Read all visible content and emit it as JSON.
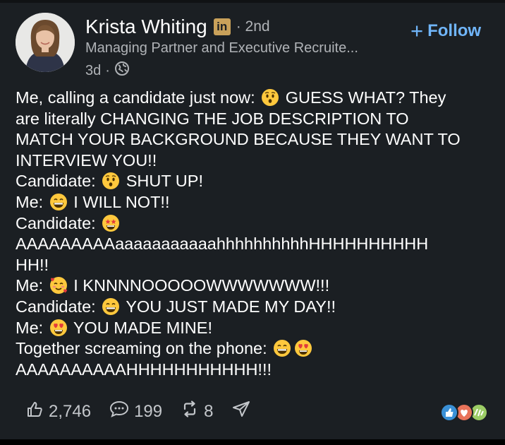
{
  "author": {
    "name": "Krista Whiting",
    "badge": "in",
    "degree": "· 2nd",
    "headline": "Managing Partner and Executive Recruite...",
    "time": "3d",
    "dot": "·"
  },
  "follow": {
    "label": "Follow"
  },
  "post": {
    "lines": [
      {
        "text": "Me, calling a candidate just now:",
        "emoji": [
          "hushed-face"
        ],
        "after": "GUESS WHAT? They"
      },
      {
        "text": "are literally CHANGING THE JOB DESCRIPTION TO"
      },
      {
        "text": "MATCH YOUR BACKGROUND BECAUSE THEY WANT TO"
      },
      {
        "text": "INTERVIEW YOU!!"
      },
      {
        "text": "Candidate:",
        "emoji": [
          "hushed-face"
        ],
        "after": "SHUT UP!"
      },
      {
        "text": "Me:",
        "emoji": [
          "grinning-face"
        ],
        "after": "I WILL NOT!!"
      },
      {
        "text": "Candidate:",
        "emoji": [
          "star-struck-face"
        ],
        "after": ""
      },
      {
        "text": "AAAAAAAAAaaaaaaaaaaahhhhhhhhhhHHHHHHHHHH"
      },
      {
        "text": "HH!!"
      },
      {
        "text": "Me:",
        "emoji": [
          "smiling-hearts-face"
        ],
        "after": "I KNNNNOOOOOWWWWWWW!!!"
      },
      {
        "text": "Candidate:",
        "emoji": [
          "grinning-face"
        ],
        "after": "YOU JUST MADE MY DAY!!"
      },
      {
        "text": "Me:",
        "emoji": [
          "heart-eyes-face"
        ],
        "after": "YOU MADE MINE!"
      },
      {
        "text": "Together screaming on the phone:",
        "emoji": [
          "grinning-face",
          "heart-eyes-face"
        ],
        "after": ""
      },
      {
        "text": "AAAAAAAAAAHHHHHHHHHHH!!!"
      }
    ]
  },
  "actions": {
    "likes": "2,746",
    "comments": "199",
    "reposts": "8"
  },
  "icons": {
    "like": "thumbs-up-icon",
    "comment": "comment-icon",
    "repost": "repost-icon",
    "send": "send-icon",
    "globe": "globe-icon",
    "reactions": "reactions-icon"
  },
  "colors": {
    "background": "#1b1f23",
    "accent": "#70b5f9",
    "muted": "#b0b3b7"
  }
}
